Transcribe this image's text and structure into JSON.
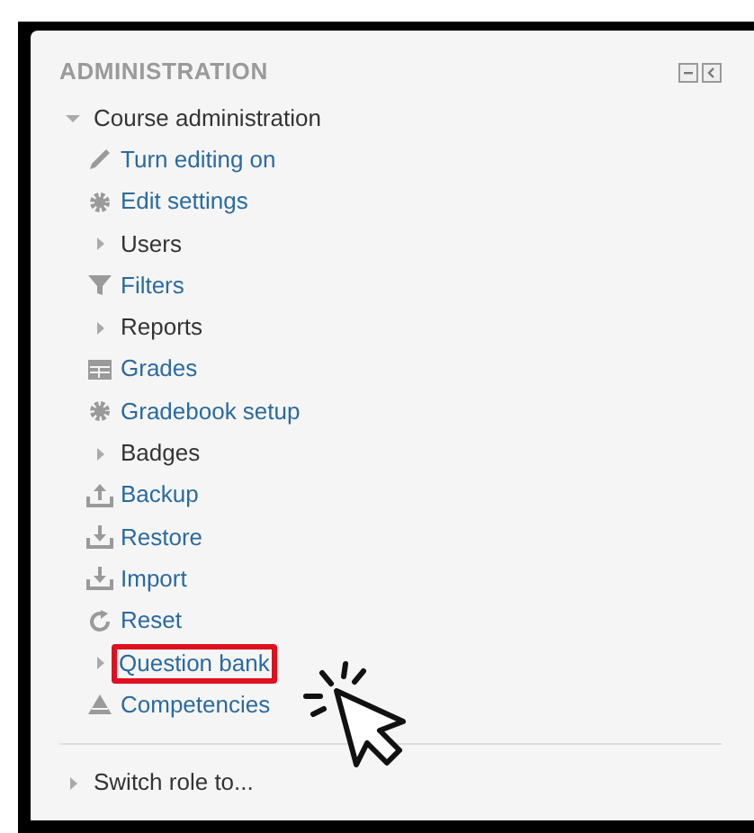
{
  "block": {
    "title": "ADMINISTRATION",
    "tree": [
      {
        "label": "Course administration",
        "kind": "branch",
        "expanded": true,
        "children": [
          {
            "label": "Turn editing on",
            "kind": "link"
          },
          {
            "label": "Edit settings",
            "kind": "link"
          },
          {
            "label": "Users",
            "kind": "branch",
            "expanded": false
          },
          {
            "label": "Filters",
            "kind": "link"
          },
          {
            "label": "Reports",
            "kind": "branch",
            "expanded": false
          },
          {
            "label": "Grades",
            "kind": "link"
          },
          {
            "label": "Gradebook setup",
            "kind": "link"
          },
          {
            "label": "Badges",
            "kind": "branch",
            "expanded": false
          },
          {
            "label": "Backup",
            "kind": "link"
          },
          {
            "label": "Restore",
            "kind": "link"
          },
          {
            "label": "Import",
            "kind": "link"
          },
          {
            "label": "Reset",
            "kind": "link"
          },
          {
            "label": "Question bank",
            "kind": "branch",
            "expanded": false,
            "highlighted": true
          },
          {
            "label": "Competencies",
            "kind": "link"
          }
        ]
      }
    ],
    "footer": [
      {
        "label": "Switch role to...",
        "kind": "branch",
        "expanded": false
      }
    ]
  }
}
